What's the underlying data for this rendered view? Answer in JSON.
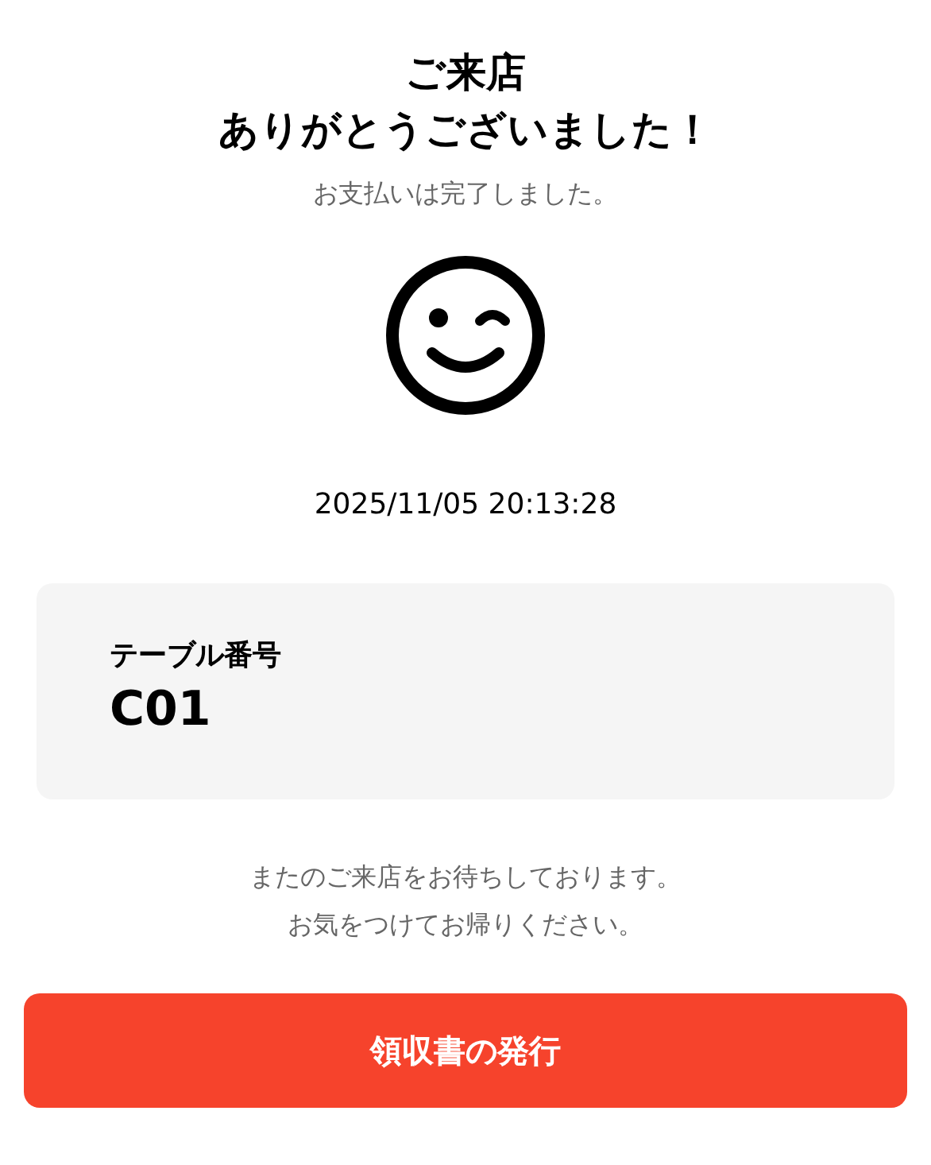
{
  "title_lines": [
    "ご来店",
    "ありがとうございました！"
  ],
  "subtitle": "お支払いは完了しました。",
  "timestamp": "2025/11/05 20:13:28",
  "table_card": {
    "label": "テーブル番号",
    "value": "C01"
  },
  "message_lines": [
    "またのご来店をお待ちしております。",
    "お気をつけてお帰りください。"
  ],
  "receipt_button": {
    "label": "領収書の発行"
  }
}
